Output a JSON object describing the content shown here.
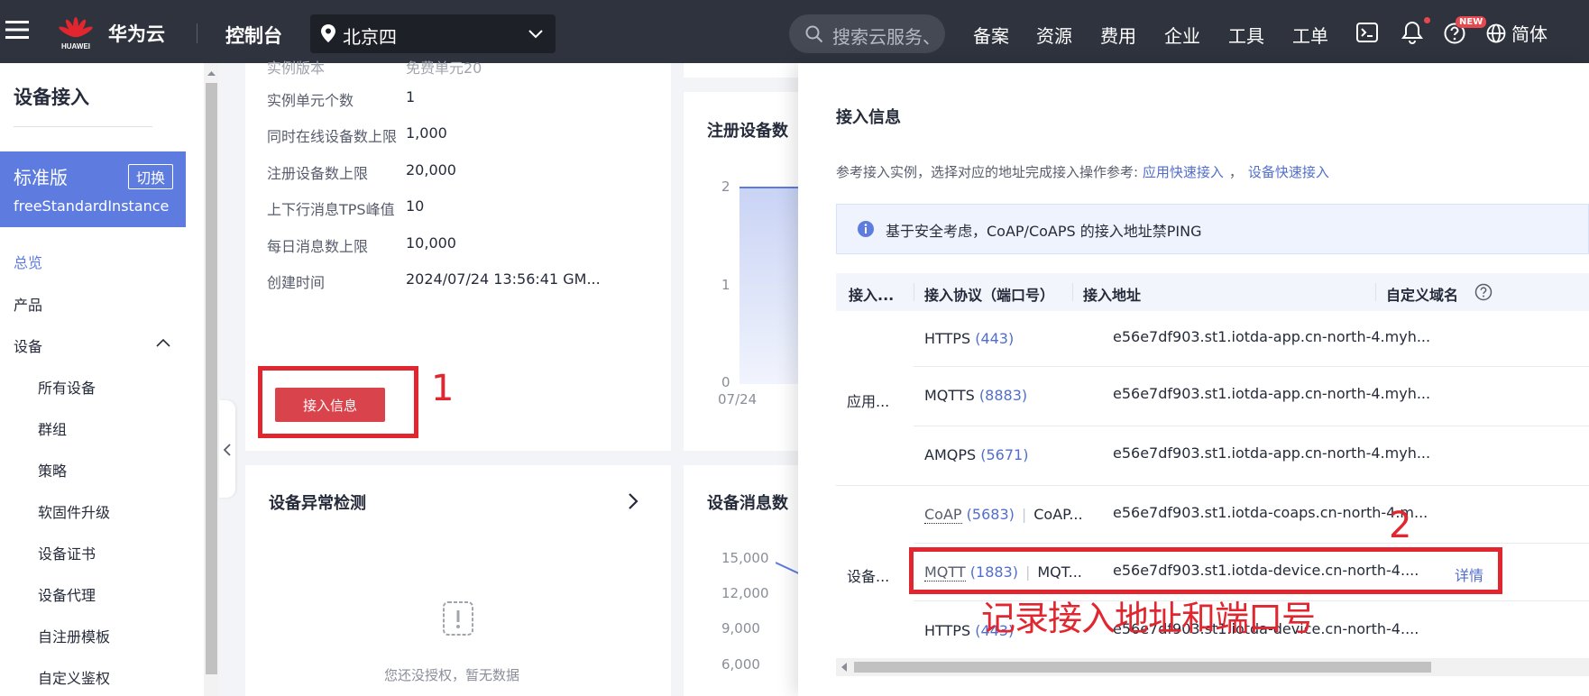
{
  "topbar": {
    "brand_logo_text": "HUAWEI",
    "brand": "华为云",
    "console": "控制台",
    "region": "北京四",
    "search_placeholder": "搜索云服务、",
    "nav_items": [
      "备案",
      "资源",
      "费用",
      "企业",
      "工具",
      "工单"
    ],
    "new_badge": "NEW",
    "language": "简体"
  },
  "sidebar": {
    "title": "设备接入",
    "edition": {
      "name": "标准版",
      "switch_label": "切换",
      "instance": "freeStandardInstance"
    },
    "items": {
      "overview": "总览",
      "product": "产品",
      "device": "设备",
      "all_devices": "所有设备",
      "group": "群组",
      "policy": "策略",
      "firmware": "软固件升级",
      "cert": "设备证书",
      "proxy": "设备代理",
      "self_register": "自注册模板",
      "custom_auth": "自定义鉴权"
    }
  },
  "instance_card": {
    "truncated_top_label": "实例版本",
    "truncated_top_value": "免费单元20",
    "rows": [
      {
        "key": "实例单元个数",
        "value": "1"
      },
      {
        "key": "同时在线设备数上限",
        "value": "1,000"
      },
      {
        "key": "注册设备数上限",
        "value": "20,000"
      },
      {
        "key": "上下行消息TPS峰值",
        "value": "10"
      },
      {
        "key": "每日消息数上限",
        "value": "10,000"
      },
      {
        "key": "创建时间",
        "value": "2024/07/24 13:56:41 GM..."
      }
    ],
    "access_info_button": "接入信息"
  },
  "annotations": {
    "num1": "1",
    "num2": "2",
    "note": "记录接入地址和端口号"
  },
  "register_card": {
    "title": "注册设备数",
    "y_ticks": [
      "2",
      "1",
      "0"
    ],
    "x_tick": "07/24"
  },
  "anomaly_card": {
    "title": "设备异常检测",
    "empty": "您还没授权，暂无数据"
  },
  "message_card": {
    "title": "设备消息数",
    "y_ticks": [
      "15,000",
      "12,000",
      "9,000",
      "6,000"
    ]
  },
  "drawer": {
    "title": "接入信息",
    "desc_prefix": "参考接入实例，选择对应的地址完成接入操作参考: ",
    "link_app": "应用快速接入",
    "desc_sep": "，",
    "link_device": "设备快速接入",
    "notice": "基于安全考虑，CoAP/CoAPS 的接入地址禁PING",
    "columns": [
      "接入...",
      "接入协议（端口号）",
      "接入地址",
      "自定义域名"
    ],
    "groups": {
      "app": "应用...",
      "device": "设备..."
    },
    "rows": [
      {
        "proto": "HTTPS",
        "port": "(443)",
        "address": "e56e7df903.st1.iotda-app.cn-north-4.myh..."
      },
      {
        "proto": "MQTTS",
        "port": "(8883)",
        "address": "e56e7df903.st1.iotda-app.cn-north-4.myh..."
      },
      {
        "proto": "AMQPS",
        "port": "(5671)",
        "address": "e56e7df903.st1.iotda-app.cn-north-4.myh..."
      },
      {
        "proto": "CoAP",
        "port": "(5683)",
        "proto2": "CoAP...",
        "address": "e56e7df903.st1.iotda-coaps.cn-north-4.m..."
      },
      {
        "proto": "MQTT",
        "port": "(1883)",
        "proto2": "MQT...",
        "address": "e56e7df903.st1.iotda-device.cn-north-4....",
        "action": "详情"
      },
      {
        "proto": "HTTPS",
        "port": "(443)",
        "address": "e56e7df903.st1.iotda-device.cn-north-4...."
      }
    ]
  }
}
